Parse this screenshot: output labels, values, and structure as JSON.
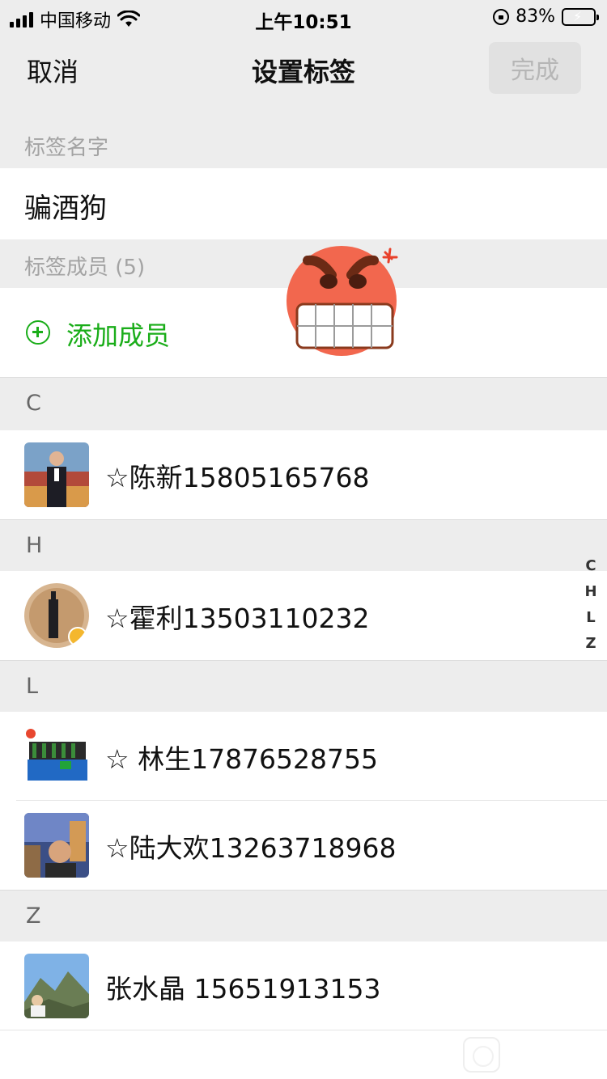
{
  "status_bar": {
    "carrier": "中国移动",
    "time": "上午10:51",
    "battery": "83%",
    "battery_level": 0.83,
    "icons": [
      "signal-icon",
      "wifi-icon",
      "rotation-lock-icon",
      "battery-charging-icon"
    ]
  },
  "nav": {
    "cancel": "取消",
    "title": "设置标签",
    "done": "完成"
  },
  "tag_name": {
    "section_label": "标签名字",
    "value": "骗酒狗"
  },
  "members": {
    "section_label": "标签成员 (5)",
    "add_label": "添加成员"
  },
  "groups": [
    {
      "letter": "C",
      "contacts": [
        {
          "name": "☆陈新15805165768"
        }
      ]
    },
    {
      "letter": "H",
      "contacts": [
        {
          "name": "☆霍利13503110232"
        }
      ]
    },
    {
      "letter": "L",
      "contacts": [
        {
          "name": "☆ 林生17876528755"
        },
        {
          "name": "☆陆大欢13263718968"
        }
      ]
    },
    {
      "letter": "Z",
      "contacts": [
        {
          "name": "张水晶 15651913153"
        }
      ]
    }
  ],
  "index_letters": [
    "C",
    "H",
    "L",
    "Z"
  ],
  "colors": {
    "accent": "#1aad19",
    "background": "#ededed",
    "disabled_button": "#e1e1e1"
  }
}
